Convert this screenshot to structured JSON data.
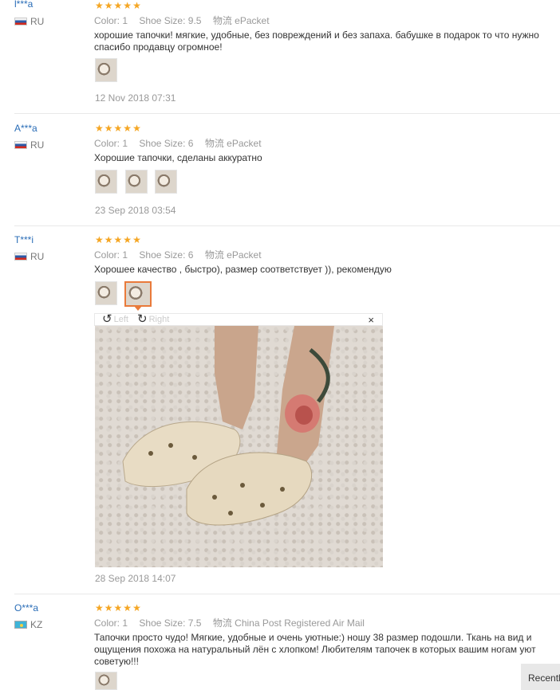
{
  "reviews": [
    {
      "user": "l***a",
      "country": "RU",
      "color_label": "Color:",
      "color_value": "1",
      "size_label": "Shoe Size:",
      "size_value": "9.5",
      "ship_label": "物流",
      "ship_value": "ePacket",
      "text": [
        "хорошие тапочки! мягкие, удобные, без повреждений и без запаха. бабушке в подарок то что нужно",
        "спасибо продавцу огромное!"
      ],
      "date": "12 Nov 2018 07:31"
    },
    {
      "user": "A***a",
      "country": "RU",
      "color_label": "Color:",
      "color_value": "1",
      "size_label": "Shoe Size:",
      "size_value": "6",
      "ship_label": "物流",
      "ship_value": "ePacket",
      "text": [
        "Хорошие тапочки, сделаны аккуратно"
      ],
      "date": "23 Sep 2018 03:54"
    },
    {
      "user": "T***i",
      "country": "RU",
      "color_label": "Color:",
      "color_value": "1",
      "size_label": "Shoe Size:",
      "size_value": "6",
      "ship_label": "物流",
      "ship_value": "ePacket",
      "text": [
        "Хорошее качество , быстро), размер соответствует )), рекомендую"
      ],
      "date": "28 Sep 2018 14:07"
    },
    {
      "user": "O***a",
      "country": "KZ",
      "color_label": "Color:",
      "color_value": "1",
      "size_label": "Shoe Size:",
      "size_value": "7.5",
      "ship_label": "物流",
      "ship_value": "China Post Registered Air Mail",
      "text": [
        "Тапочки просто чудо! Мягкие, удобные и очень уютные:) ношу 38 размер подошли. Ткань на вид и",
        "ощущения похожа на натуральный лён с хлопком! Любителям тапочек в которых вашим ногам уют",
        "советую!!!"
      ]
    }
  ],
  "viewer": {
    "left_label": "Left",
    "right_label": "Right",
    "close": "×"
  },
  "recent_label": "Recently"
}
